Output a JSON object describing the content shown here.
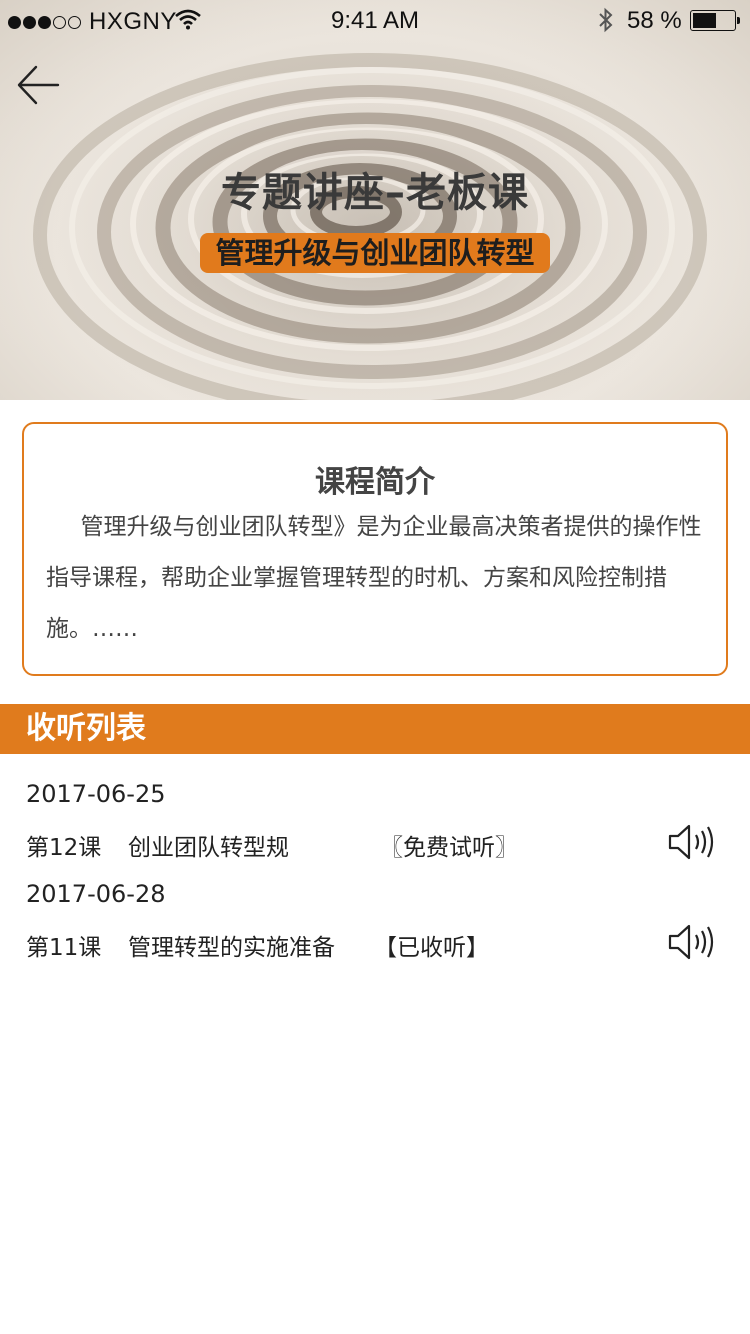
{
  "status_bar": {
    "carrier": "HXGNY",
    "time": "9:41 AM",
    "battery_text": "58 %",
    "battery_level": 0.58
  },
  "hero": {
    "title": "专题讲座–老板课",
    "subtitle": "管理升级与创业团队转型"
  },
  "intro": {
    "title": "课程简介",
    "text": "管理升级与创业团队转型》是为企业最高决策者提供的操作性指导课程，帮助企业掌握管理转型的时机、方案和风险控制措施。……"
  },
  "list_header": "收听列表",
  "lessons": [
    {
      "date": "2017-06-25",
      "number": "第12课",
      "title": "创业团队转型规",
      "status": "〖免费试听〗"
    },
    {
      "date": "2017-06-28",
      "number": "第11课",
      "title": "管理转型的实施准备",
      "status": "【已收听】"
    }
  ],
  "colors": {
    "accent": "#e07b1d",
    "text": "#333333"
  }
}
